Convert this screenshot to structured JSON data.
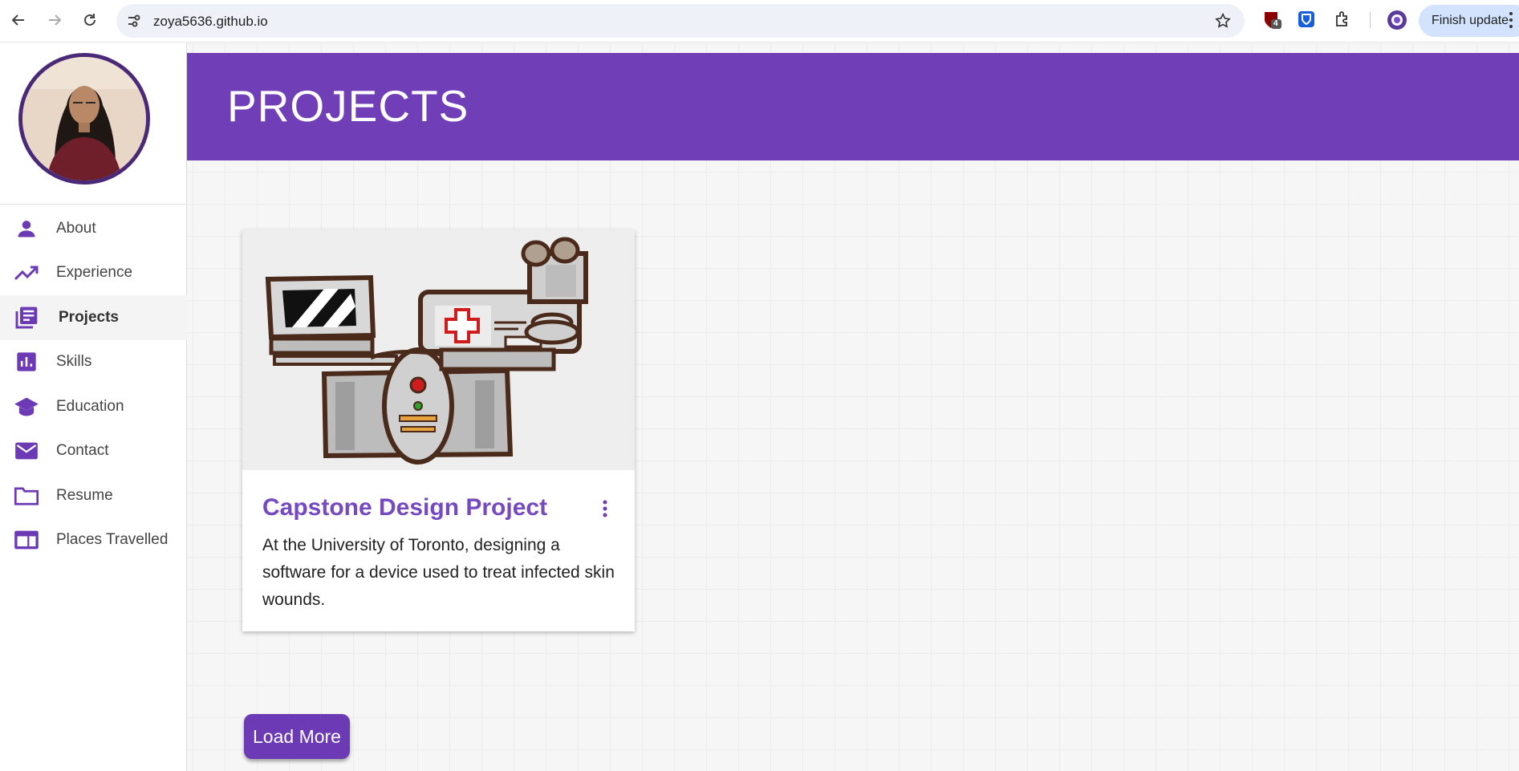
{
  "browser": {
    "url": "zoya5636.github.io",
    "finish_update_label": "Finish update",
    "extension_badge_count": "4"
  },
  "sidebar": {
    "items": [
      {
        "label": "About",
        "icon": "person-icon"
      },
      {
        "label": "Experience",
        "icon": "trending-up-icon"
      },
      {
        "label": "Projects",
        "icon": "library-books-icon",
        "active": true
      },
      {
        "label": "Skills",
        "icon": "bar-chart-icon"
      },
      {
        "label": "Education",
        "icon": "school-icon"
      },
      {
        "label": "Contact",
        "icon": "mail-icon"
      },
      {
        "label": "Resume",
        "icon": "folder-icon"
      },
      {
        "label": "Places Travelled",
        "icon": "web-icon"
      }
    ]
  },
  "header": {
    "title": "PROJECTS"
  },
  "projects": [
    {
      "title": "Capstone Design Project",
      "description": "At the University of Toronto, designing a software for a device used to treat infected skin wounds."
    }
  ],
  "load_more_label": "Load More",
  "colors": {
    "accent": "#703fb8",
    "card_title": "#7549c0",
    "button": "#6c3ab5"
  }
}
